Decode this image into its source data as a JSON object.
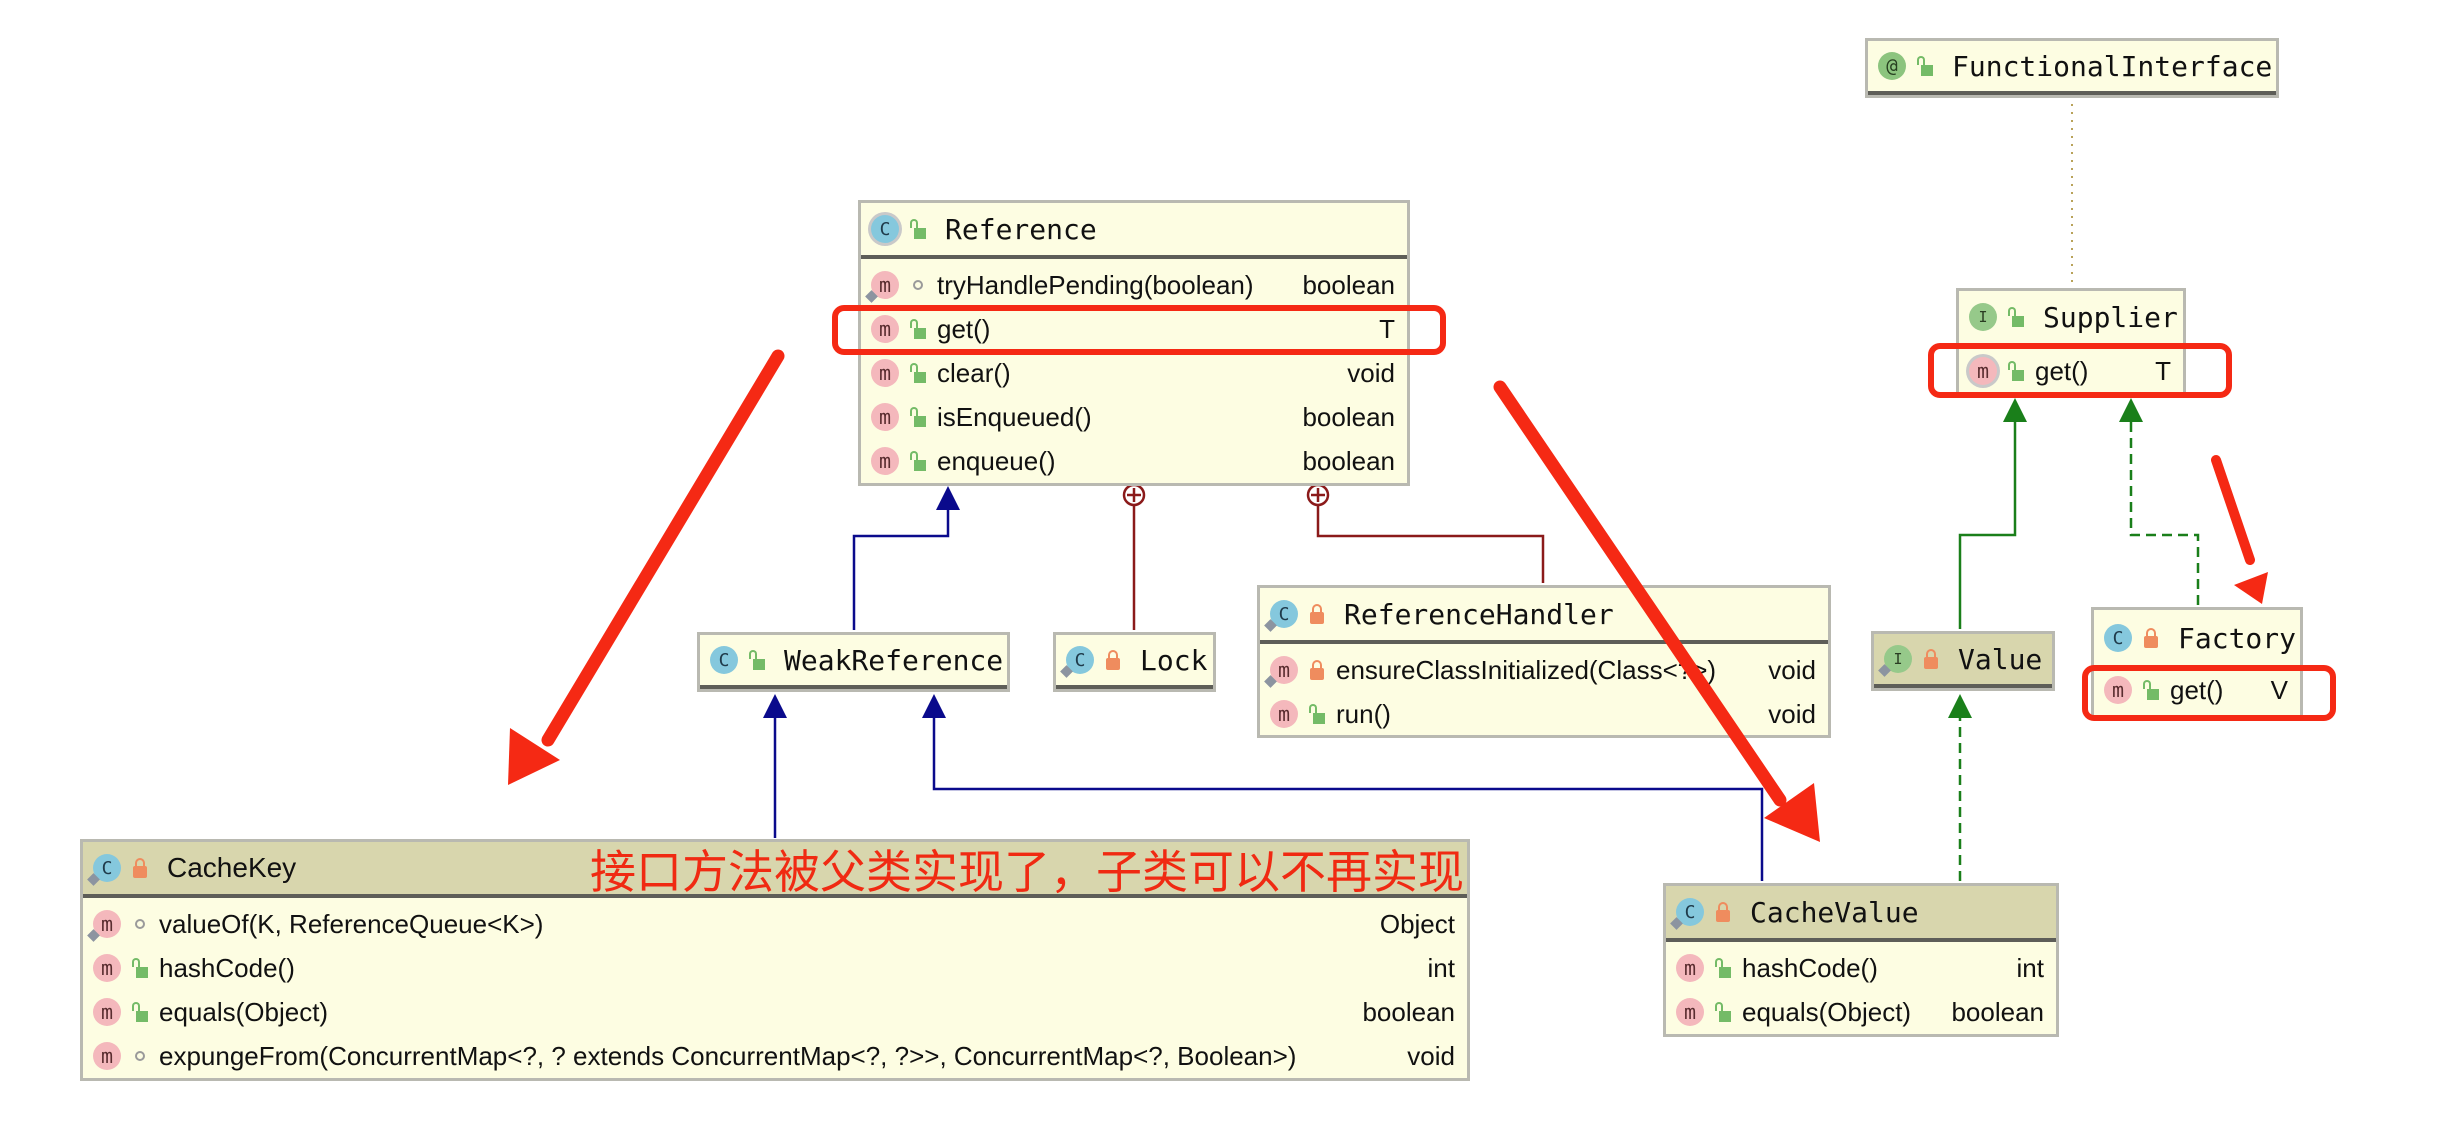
{
  "diagram": {
    "type": "uml-class-diagram",
    "nodes": {
      "functional_interface": {
        "kind": "annotation",
        "kind_icon": "@",
        "visibility": "public",
        "name": "FunctionalInterface",
        "members": []
      },
      "reference": {
        "kind": "abstract-class",
        "kind_icon": "C",
        "visibility": "public",
        "name": "Reference",
        "members": [
          {
            "name": "tryHandlePending(boolean)",
            "type": "boolean",
            "visibility": "package",
            "static": true
          },
          {
            "name": "get()",
            "type": "T",
            "visibility": "public"
          },
          {
            "name": "clear()",
            "type": "void",
            "visibility": "public"
          },
          {
            "name": "isEnqueued()",
            "type": "boolean",
            "visibility": "public"
          },
          {
            "name": "enqueue()",
            "type": "boolean",
            "visibility": "public"
          }
        ]
      },
      "supplier": {
        "kind": "interface",
        "kind_icon": "I",
        "visibility": "public",
        "name": "Supplier",
        "members": [
          {
            "name": "get()",
            "type": "T",
            "visibility": "public",
            "abstract": true
          }
        ]
      },
      "weak_reference": {
        "kind": "class",
        "kind_icon": "C",
        "visibility": "public",
        "name": "WeakReference",
        "members": []
      },
      "lock": {
        "kind": "class",
        "kind_icon": "C",
        "visibility": "private",
        "static": true,
        "name": "Lock",
        "members": []
      },
      "reference_handler": {
        "kind": "class",
        "kind_icon": "C",
        "visibility": "private",
        "static": true,
        "name": "ReferenceHandler",
        "members": [
          {
            "name": "ensureClassInitialized(Class<?>)",
            "type": "void",
            "visibility": "private",
            "static": true
          },
          {
            "name": "run()",
            "type": "void",
            "visibility": "public"
          }
        ]
      },
      "value": {
        "kind": "interface",
        "kind_icon": "I",
        "visibility": "private",
        "static": true,
        "name": "Value",
        "members": []
      },
      "factory": {
        "kind": "class",
        "kind_icon": "C",
        "visibility": "private",
        "final": true,
        "name": "Factory",
        "members": [
          {
            "name": "get()",
            "type": "V",
            "visibility": "public"
          }
        ]
      },
      "cache_key": {
        "kind": "class",
        "kind_icon": "C",
        "visibility": "private",
        "static": true,
        "name": "CacheKey",
        "members": [
          {
            "name": "valueOf(K, ReferenceQueue<K>)",
            "type": "Object",
            "visibility": "package",
            "static": true
          },
          {
            "name": "hashCode()",
            "type": "int",
            "visibility": "public"
          },
          {
            "name": "equals(Object)",
            "type": "boolean",
            "visibility": "public"
          },
          {
            "name": "expungeFrom(ConcurrentMap<?, ? extends ConcurrentMap<?, ?>>, ConcurrentMap<?, Boolean>)",
            "type": "void",
            "visibility": "package"
          }
        ]
      },
      "cache_value": {
        "kind": "class",
        "kind_icon": "C",
        "visibility": "private",
        "static": true,
        "name": "CacheValue",
        "members": [
          {
            "name": "hashCode()",
            "type": "int",
            "visibility": "public"
          },
          {
            "name": "equals(Object)",
            "type": "boolean",
            "visibility": "public"
          }
        ]
      }
    },
    "edges": [
      {
        "from": "Supplier",
        "to": "FunctionalInterface",
        "relation": "annotated-by",
        "style": "dotted"
      },
      {
        "from": "WeakReference",
        "to": "Reference",
        "relation": "extends",
        "style": "solid",
        "color": "#0a0a8c"
      },
      {
        "from": "Lock",
        "to": "Reference",
        "relation": "inner-class",
        "style": "solid",
        "color": "#8b1a1a"
      },
      {
        "from": "ReferenceHandler",
        "to": "Reference",
        "relation": "inner-class",
        "style": "solid",
        "color": "#8b1a1a"
      },
      {
        "from": "CacheKey",
        "to": "WeakReference",
        "relation": "extends",
        "style": "solid",
        "color": "#0a0a8c"
      },
      {
        "from": "CacheValue",
        "to": "WeakReference",
        "relation": "extends",
        "style": "solid",
        "color": "#0a0a8c"
      },
      {
        "from": "Value",
        "to": "Supplier",
        "relation": "extends",
        "style": "solid",
        "color": "#1a7f1a"
      },
      {
        "from": "Factory",
        "to": "Supplier",
        "relation": "implements",
        "style": "dashed",
        "color": "#1a7f1a"
      },
      {
        "from": "CacheValue",
        "to": "Value",
        "relation": "implements",
        "style": "dashed",
        "color": "#1a7f1a"
      }
    ]
  },
  "annotations": {
    "note_text": "接口方法被父类实现了，子类可以不再实现",
    "highlight_color": "#f52914",
    "highlighted_members": [
      "Reference.get()",
      "Supplier.get()",
      "Factory.get()"
    ],
    "arrows": [
      {
        "points_to": "CacheKey",
        "color": "#f52914"
      },
      {
        "points_to": "CacheValue",
        "color": "#f52914"
      },
      {
        "points_to": "Factory",
        "color": "#f52914"
      }
    ]
  },
  "colors": {
    "node_fill": "#fdfde2",
    "node_header_olive": "#d8d6ad",
    "extends_blue": "#0a0a8c",
    "inner_red": "#8b1a1a",
    "interface_green": "#1a7f1a"
  }
}
